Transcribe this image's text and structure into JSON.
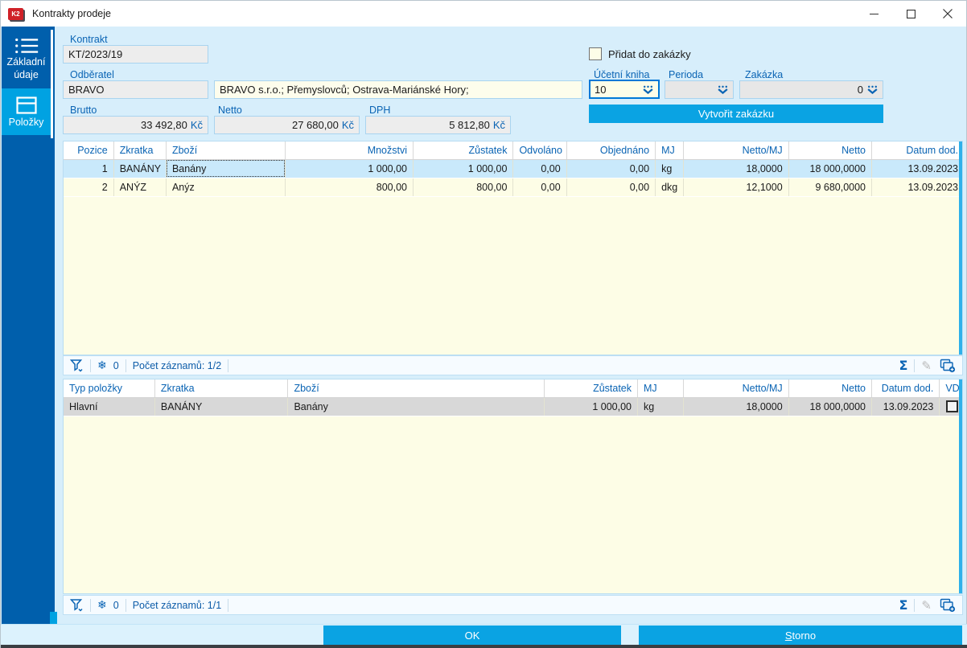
{
  "window": {
    "title": "Kontrakty prodeje",
    "app_icon_text": "K2"
  },
  "sidebar": {
    "items": [
      {
        "label": "Základní údaje",
        "icon": "list-icon",
        "active": false
      },
      {
        "label": "Položky",
        "icon": "box-icon",
        "active": true
      }
    ]
  },
  "form": {
    "kontrakt_label": "Kontrakt",
    "kontrakt_value": "KT/2023/19",
    "odberatel_label": "Odběratel",
    "odberatel_code": "BRAVO",
    "odberatel_name": "BRAVO s.r.o.; Přemyslovců; Ostrava-Mariánské Hory;",
    "pridat_checkbox_label": "Přidat do zakázky",
    "ucetni_kniha_label": "Účetní kniha",
    "ucetni_kniha_value": "10",
    "perioda_label": "Perioda",
    "perioda_value": "",
    "zakazka_label": "Zakázka",
    "zakazka_value": "0",
    "brutto_label": "Brutto",
    "brutto_value": "33 492,80",
    "netto_label": "Netto",
    "netto_value": "27 680,00",
    "dph_label": "DPH",
    "dph_value": "5 812,80",
    "currency": "Kč",
    "vytvorit_button": "Vytvořit zakázku"
  },
  "items_table": {
    "columns": [
      "Pozice",
      "Zkratka",
      "Zboží",
      "Množstvi",
      "Zůstatek",
      "Odvoláno",
      "Objednáno",
      "MJ",
      "Netto/MJ",
      "Netto",
      "Datum dod."
    ],
    "rows": [
      [
        "1",
        "BANÁNY",
        "Banány",
        "1 000,00",
        "1 000,00",
        "0,00",
        "0,00",
        "kg",
        "18,0000",
        "18 000,0000",
        "13.09.2023"
      ],
      [
        "2",
        "ANÝZ",
        "Anýz",
        "800,00",
        "800,00",
        "0,00",
        "0,00",
        "dkg",
        "12,1000",
        "9 680,0000",
        "13.09.2023"
      ]
    ],
    "filter_badge": "0",
    "record_count": "Počet záznamů: 1/2"
  },
  "subitems_table": {
    "columns": [
      "Typ položky",
      "Zkratka",
      "Zboží",
      "Zůstatek",
      "MJ",
      "Netto/MJ",
      "Netto",
      "Datum dod.",
      "VD"
    ],
    "rows": [
      [
        "Hlavní",
        "BANÁNY",
        "Banány",
        "1 000,00",
        "kg",
        "18,0000",
        "18 000,0000",
        "13.09.2023"
      ]
    ],
    "filter_badge": "0",
    "record_count": "Počet záznamů: 1/1"
  },
  "status_icons": {
    "sum": "Σ",
    "snowflake": "❄",
    "pencil": "✎"
  },
  "footer": {
    "ok": "OK",
    "storno_initial": "S",
    "storno_rest": "torno"
  },
  "colors": {
    "accent_cyan": "#0aa3e3",
    "sidebar_blue": "#005fac",
    "label_blue": "#0a64b4",
    "grid_cream": "#fdfde6",
    "selected_row_blue": "#c9e9fb",
    "selected_row_gray": "#d8d8d8",
    "app_icon_red": "#cf2128"
  }
}
